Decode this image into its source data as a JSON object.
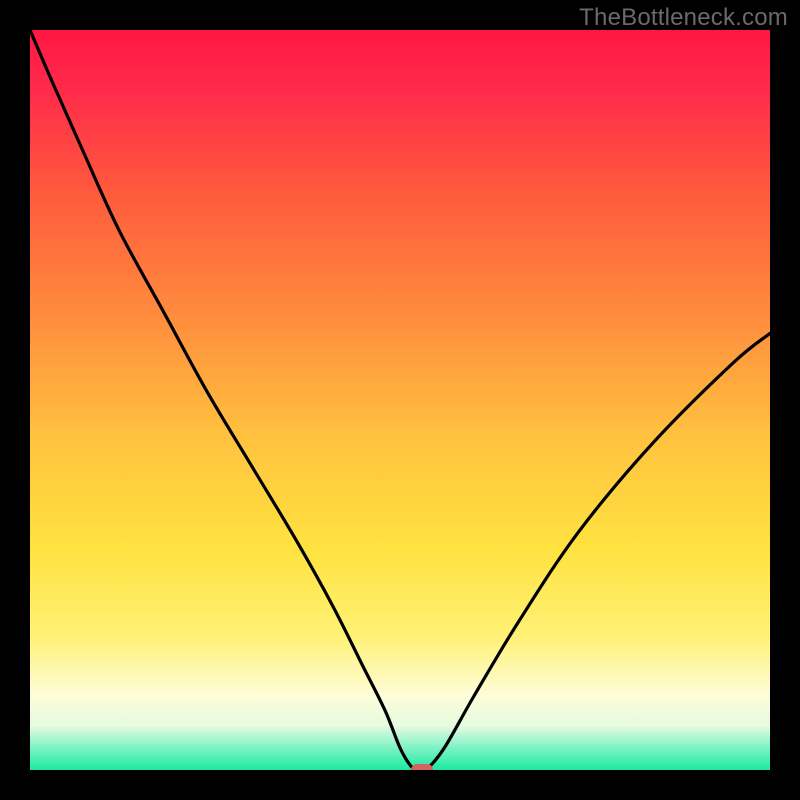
{
  "watermark": "TheBottleneck.com",
  "colors": {
    "frame": "#000000",
    "watermark_text": "#6a6a6a",
    "curve": "#000000",
    "marker": "#d4645d",
    "gradient": {
      "top": "#ff1744",
      "upper_mid": "#ff8a3d",
      "mid": "#ffd23f",
      "lower_mid": "#fff176",
      "pale": "#fdfdd9",
      "green": "#1de9b6"
    }
  },
  "chart_data": {
    "type": "line",
    "title": "",
    "xlabel": "",
    "ylabel": "",
    "xlim": [
      0,
      100
    ],
    "ylim": [
      0,
      100
    ],
    "annotations": [
      "TheBottleneck.com"
    ],
    "series": [
      {
        "name": "bottleneck-curve",
        "x": [
          0,
          3,
          7,
          12,
          18,
          24,
          30,
          36,
          41,
          45,
          48,
          50,
          51.5,
          52.5,
          53.5,
          56,
          60,
          66,
          74,
          84,
          95,
          100
        ],
        "y": [
          100,
          93,
          84,
          73,
          62,
          51,
          41,
          31,
          22,
          14,
          8,
          3,
          0.5,
          0,
          0,
          3,
          10,
          20,
          32,
          44,
          55,
          59
        ]
      }
    ],
    "marker": {
      "x": 53,
      "y": 0
    },
    "gradient_stops_pct": [
      0,
      35,
      55,
      72,
      88,
      93,
      97,
      100
    ]
  }
}
